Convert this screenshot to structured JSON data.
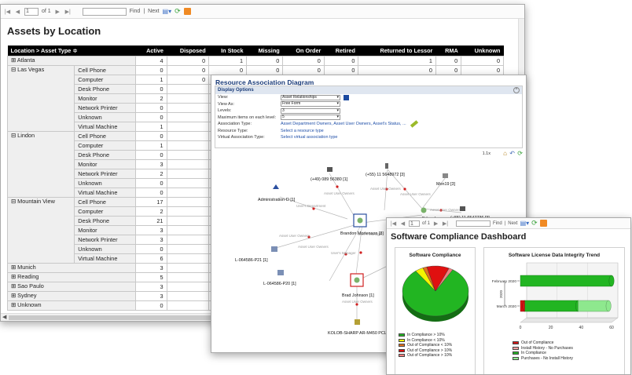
{
  "assets": {
    "toolbar": {
      "page": "1",
      "of": "of 1",
      "find": "Find",
      "sep": "|",
      "next": "Next"
    },
    "title": "Assets by Location",
    "columns": [
      "Location > Asset Type ≑",
      "Active",
      "Disposed",
      "In Stock",
      "Missing",
      "On Order",
      "Retired",
      "Returned to Lessor",
      "RMA",
      "Unknown"
    ],
    "rows": [
      {
        "loc": "⊞ Atlanta",
        "type": null,
        "span": 1,
        "vals": [
          "4",
          "0",
          "1",
          "0",
          "0",
          "0",
          "1",
          "0",
          "0"
        ]
      },
      {
        "loc": "⊟ Las Vegas",
        "type": "Cell Phone",
        "span": 7,
        "vals": [
          "0",
          "0",
          "0",
          "0",
          "0",
          "0",
          "0",
          "0",
          "0"
        ]
      },
      {
        "loc": null,
        "type": "Computer",
        "vals": [
          "1",
          "0",
          "0",
          "0",
          "0",
          "0",
          "0",
          "0",
          "0"
        ]
      },
      {
        "loc": null,
        "type": "Desk Phone",
        "vals": [
          "0",
          "",
          "",
          " ",
          "",
          "",
          "",
          "",
          ""
        ]
      },
      {
        "loc": null,
        "type": "Monitor",
        "vals": [
          "2",
          "",
          "",
          "",
          "",
          "",
          "",
          "",
          ""
        ]
      },
      {
        "loc": null,
        "type": "Network Printer",
        "vals": [
          "0",
          "",
          "",
          "",
          "",
          "",
          "",
          "",
          ""
        ]
      },
      {
        "loc": null,
        "type": "Unknown",
        "vals": [
          "0",
          "",
          "",
          "",
          "",
          "",
          "",
          "",
          ""
        ]
      },
      {
        "loc": null,
        "type": "Virtual Machine",
        "vals": [
          "1",
          "",
          "",
          "",
          "",
          "",
          "",
          "",
          ""
        ]
      },
      {
        "loc": "⊟ Lindon",
        "type": "Cell Phone",
        "span": 7,
        "vals": [
          "0",
          "",
          "",
          "",
          "",
          "",
          "",
          "",
          ""
        ]
      },
      {
        "loc": null,
        "type": "Computer",
        "vals": [
          "1",
          "",
          "",
          "",
          "",
          "",
          "",
          "",
          ""
        ]
      },
      {
        "loc": null,
        "type": "Desk Phone",
        "vals": [
          "0",
          "",
          "",
          "",
          "",
          "",
          "",
          "",
          ""
        ]
      },
      {
        "loc": null,
        "type": "Monitor",
        "vals": [
          "3",
          "",
          "",
          "",
          "",
          "",
          "",
          "",
          ""
        ]
      },
      {
        "loc": null,
        "type": "Network Printer",
        "vals": [
          "2",
          "",
          "",
          "",
          "",
          "",
          "",
          "",
          ""
        ]
      },
      {
        "loc": null,
        "type": "Unknown",
        "vals": [
          "0",
          "",
          "",
          "",
          "",
          "",
          "",
          "",
          ""
        ]
      },
      {
        "loc": null,
        "type": "Virtual Machine",
        "vals": [
          "0",
          "",
          "",
          "",
          "",
          "",
          "",
          "",
          ""
        ]
      },
      {
        "loc": "⊟ Mountain View",
        "type": "Cell Phone",
        "span": 7,
        "vals": [
          "17",
          "",
          "",
          "",
          "",
          "",
          "",
          "",
          ""
        ]
      },
      {
        "loc": null,
        "type": "Computer",
        "vals": [
          "2",
          "",
          "",
          "",
          "",
          "",
          "",
          "",
          ""
        ]
      },
      {
        "loc": null,
        "type": "Desk Phone",
        "vals": [
          "21",
          "",
          "",
          "",
          "",
          "",
          "",
          "",
          ""
        ]
      },
      {
        "loc": null,
        "type": "Monitor",
        "vals": [
          "3",
          "",
          "",
          "",
          "",
          "",
          "",
          "",
          ""
        ]
      },
      {
        "loc": null,
        "type": "Network Printer",
        "vals": [
          "3",
          "",
          "",
          "",
          "",
          "",
          "",
          "",
          ""
        ]
      },
      {
        "loc": null,
        "type": "Unknown",
        "vals": [
          "0",
          "",
          "",
          "",
          "",
          "",
          "",
          "",
          ""
        ]
      },
      {
        "loc": null,
        "type": "Virtual Machine",
        "vals": [
          "6",
          "",
          "",
          "",
          "",
          "",
          "",
          "",
          ""
        ]
      },
      {
        "loc": "⊞ Munich",
        "type": null,
        "span": 1,
        "vals": [
          "3",
          "",
          "",
          "",
          "",
          "",
          "",
          "",
          ""
        ]
      },
      {
        "loc": "⊞ Reading",
        "type": null,
        "span": 1,
        "vals": [
          "5",
          "",
          "",
          "",
          "",
          "",
          "",
          "",
          ""
        ]
      },
      {
        "loc": "⊞ Sao Paulo",
        "type": null,
        "span": 1,
        "vals": [
          "3",
          "",
          "",
          "",
          "",
          "",
          "",
          "",
          ""
        ]
      },
      {
        "loc": "⊞ Sydney",
        "type": null,
        "span": 1,
        "vals": [
          "3",
          "",
          "",
          "",
          "",
          "",
          "",
          "",
          ""
        ]
      },
      {
        "loc": "⊞ Unknown",
        "type": null,
        "span": 1,
        "vals": [
          "0",
          "",
          "",
          "",
          "",
          "",
          "",
          "",
          ""
        ]
      }
    ]
  },
  "diagram": {
    "title": "Resource Association Diagram",
    "panel_title": "Display Options",
    "options": [
      {
        "label": "View:",
        "kind": "select",
        "value": "Asset Relationships"
      },
      {
        "label": "View As:",
        "kind": "select",
        "value": "Free Form"
      },
      {
        "label": "Levels:",
        "kind": "select",
        "value": "3"
      },
      {
        "label": "Maximum items on each level:",
        "kind": "select",
        "value": "5"
      },
      {
        "label": "Association Type:",
        "kind": "link",
        "value": "Asset Department Owners, Asset User Owners, Asset's Status, ..."
      },
      {
        "label": "Resource Type:",
        "kind": "link",
        "value": "Select a resource type"
      },
      {
        "label": "Virtual Association Type:",
        "kind": "link",
        "value": "Select virtual association type"
      }
    ],
    "zoom": "1.1x",
    "nodes": {
      "phone1": "(+49) 089 56380 [1]",
      "phone2": "(+55) 11 5648972 [3]",
      "admin": "Administration-D [1]",
      "mon": "Mon19 [3]",
      "brandon": "Brandon Mortenson [8]",
      "eduardo": "Eduardo",
      "phone3": "(+55) 11 6547736 [3]",
      "l21": "L-064586-P21 [1]",
      "l20": "L-064586-P20 [1]",
      "brad": "Brad Johnson [1]",
      "kolob": "KOLOB-SHARP AR-M450 PCL"
    },
    "edges": {
      "auo": "Asset User Owners",
      "ud": "User's Department",
      "um": "User's Manager"
    }
  },
  "compliance": {
    "toolbar": {
      "page": "1",
      "of": "of 1",
      "find": "Find",
      "sep": "|",
      "next": "Next"
    },
    "title": "Software Compliance Dashboard",
    "pie_title": "Software Compliance",
    "bar_title": "Software License Data Integrity Trend",
    "pie_legend": [
      {
        "label": "In Compliance > 10%",
        "color": "#22b522"
      },
      {
        "label": "In Compliance < 10%",
        "color": "#f4f400"
      },
      {
        "label": "Out of Compliance < 10%",
        "color": "#e07020"
      },
      {
        "label": "Out of Compliance > 10%",
        "color": "#e01010"
      },
      {
        "label": "Out of Compliance > 10%",
        "color": "#f08080"
      }
    ],
    "bar_legend": [
      {
        "label": "Out of Compliance",
        "color": "#d41414"
      },
      {
        "label": "Install History - No Purchases",
        "color": "#f0a0a0"
      },
      {
        "label": "In Compliance",
        "color": "#22b522"
      },
      {
        "label": "Purchases - No Install History",
        "color": "#8ee88e"
      }
    ],
    "axis_year": "2020",
    "chart_data": {
      "type": "bar",
      "categories": [
        "February 2020",
        "March 2020"
      ],
      "x_ticks": [
        "0",
        "20",
        "40",
        "60"
      ],
      "xlim": [
        0,
        60
      ],
      "series": [
        {
          "name": "Out of Compliance",
          "values": [
            0,
            3
          ]
        },
        {
          "name": "Install History - No Purchases",
          "values": [
            0,
            0
          ]
        },
        {
          "name": "In Compliance",
          "values": [
            60,
            35
          ]
        },
        {
          "name": "Purchases - No Install History",
          "values": [
            0,
            20
          ]
        }
      ],
      "pie": [
        {
          "name": "In Compliance > 10%",
          "value": 81
        },
        {
          "name": "In Compliance < 10%",
          "value": 4
        },
        {
          "name": "Out of Compliance < 10%",
          "value": 2
        },
        {
          "name": "Out of Compliance > 10%",
          "value": 11
        },
        {
          "name": "Out of Compliance > 10%",
          "value": 2
        }
      ]
    }
  }
}
